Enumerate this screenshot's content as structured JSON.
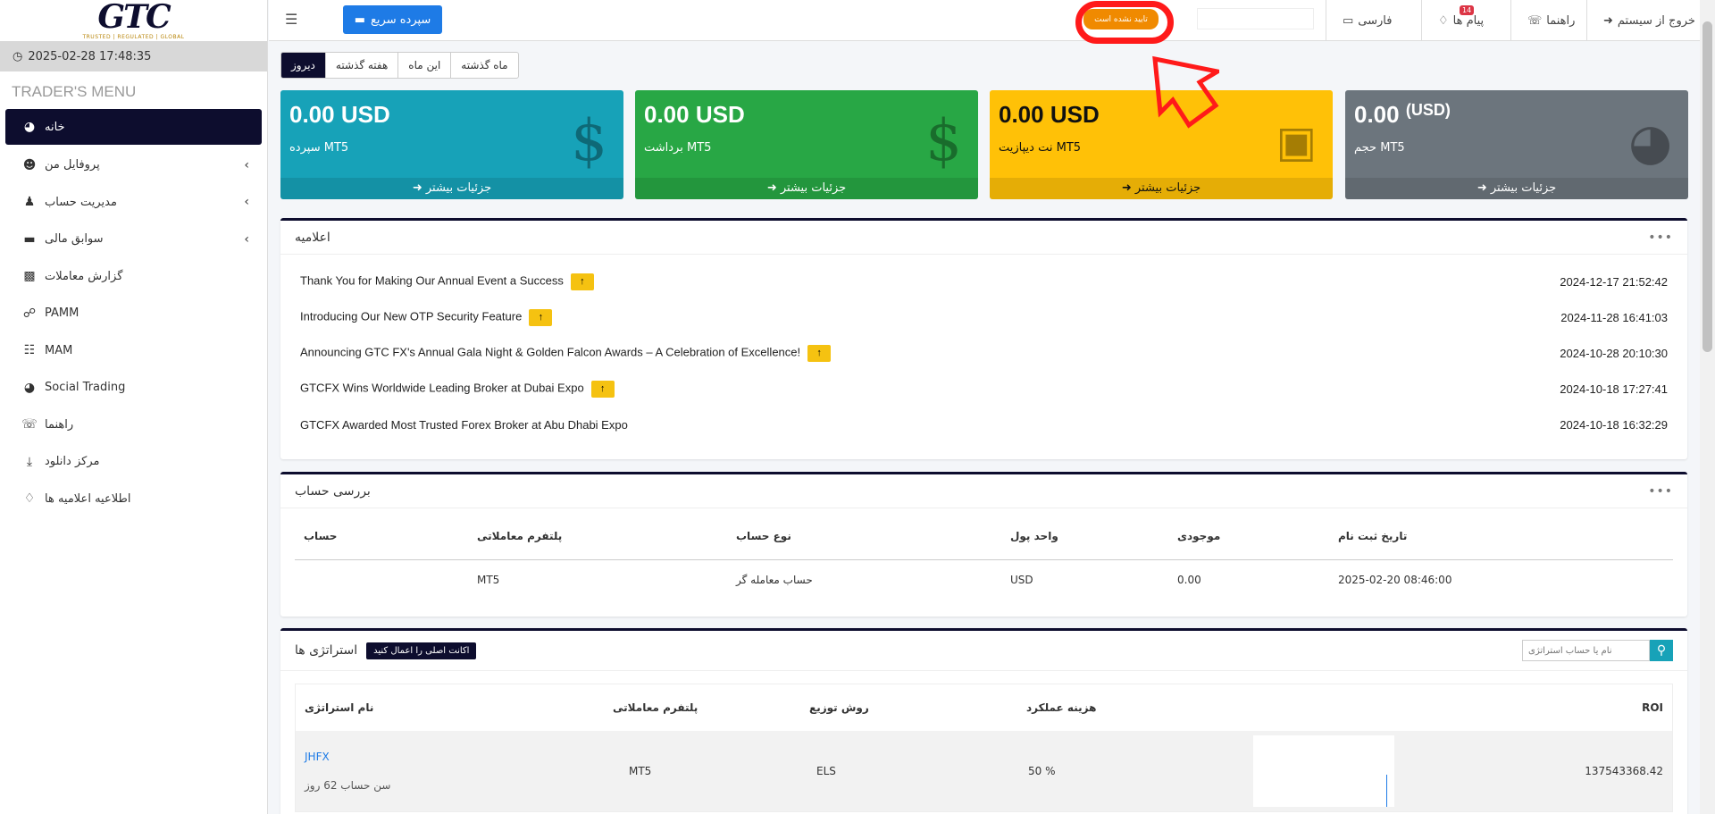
{
  "logo": {
    "text": "GTC",
    "tagline": "TRUSTED | REGULATED | GLOBAL"
  },
  "datetime": "2025-02-28 17:48:35",
  "menu_title": "TRADER'S MENU",
  "nav": [
    {
      "label": "خانه"
    },
    {
      "label": "پروفایل من"
    },
    {
      "label": "مدیریت حساب"
    },
    {
      "label": "سوابق مالی"
    },
    {
      "label": "گزارش معاملات"
    },
    {
      "label": "PAMM"
    },
    {
      "label": "MAM"
    },
    {
      "label": "Social Trading"
    },
    {
      "label": "راهنما"
    },
    {
      "label": "مرکز دانلود"
    },
    {
      "label": "اطلاعیه اعلامیه ها"
    }
  ],
  "topbar": {
    "quick_deposit": "سپرده سریع",
    "status_badge": "تایید نشده است",
    "language": "فارسی",
    "messages": "پیام ها",
    "messages_count": "14",
    "help": "راهنما",
    "logout": "خروج از سیستم"
  },
  "period": {
    "items": [
      "ماه گذشته",
      "این ماه",
      "هفته گذشته",
      "دیروز"
    ]
  },
  "cards": [
    {
      "amount": "0.00 USD",
      "label": "سپرده MT5",
      "footer": "جزئیات بیشتر",
      "color": "#17a2b8"
    },
    {
      "amount": "0.00 USD",
      "label": "برداشت MT5",
      "footer": "جزئیات بیشتر",
      "color": "#28a745"
    },
    {
      "amount": "0.00 USD",
      "label": "نت دیپازیت MT5",
      "footer": "جزئیات بیشتر",
      "color": "#ffc107"
    },
    {
      "amount": "0.00",
      "amount_unit": "(USD)",
      "label": "حجم MT5",
      "footer": "جزئیات بیشتر",
      "color": "#6c757d"
    }
  ],
  "announcements": {
    "title": "اعلامیه",
    "tag": "↑",
    "items": [
      {
        "text": "Thank You for Making Our Annual Event a Success",
        "date": "2024-12-17 21:52:42",
        "tagged": true
      },
      {
        "text": "Introducing Our New OTP Security Feature",
        "date": "2024-11-28 16:41:03",
        "tagged": true
      },
      {
        "text": "Announcing GTC FX's Annual Gala Night & Golden Falcon Awards – A Celebration of Excellence!",
        "date": "2024-10-28 20:10:30",
        "tagged": true
      },
      {
        "text": "GTCFX Wins Worldwide Leading Broker at Dubai Expo",
        "date": "2024-10-18 17:27:41",
        "tagged": true
      },
      {
        "text": "GTCFX Awarded Most Trusted Forex Broker at Abu Dhabi Expo",
        "date": "2024-10-18 16:32:29",
        "tagged": false
      }
    ]
  },
  "account_review": {
    "title": "بررسی حساب",
    "headers": [
      "حساب",
      "پلتفرم معاملاتی",
      "نوع حساب",
      "واحد پول",
      "موجودی",
      "تاریخ ثبت نام"
    ],
    "rows": [
      [
        "",
        "MT5",
        "حساب معامله گر",
        "USD",
        "0.00",
        "2025-02-20 08:46:00"
      ]
    ]
  },
  "strategies": {
    "title": "استراتژی ها",
    "apply_button": "اکانت اصلی را اعمال کنید",
    "search_placeholder": "نام یا حساب استراتژی",
    "headers": [
      "نام استراتژی",
      "پلتفرم معاملاتی",
      "روش توزیع",
      "هزینه عملکرد",
      "ROI"
    ],
    "rows": [
      {
        "name": "JHFX",
        "age": "سن حساب 62 روز",
        "platform": "MT5",
        "distribution": "ELS",
        "fee": "50 %",
        "roi": "137543368.42"
      }
    ]
  }
}
